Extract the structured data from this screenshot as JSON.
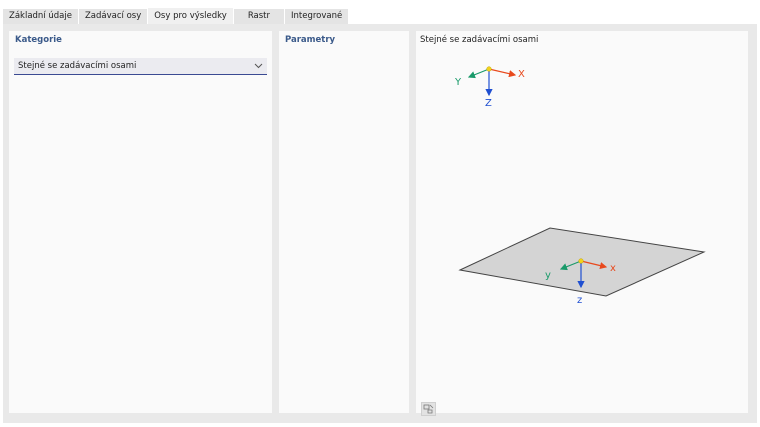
{
  "tabs": [
    {
      "label": "Základní údaje"
    },
    {
      "label": "Zadávací osy"
    },
    {
      "label": "Osy pro výsledky",
      "active": true
    },
    {
      "label": "Rastr"
    },
    {
      "label": "Integrované"
    }
  ],
  "kategorie": {
    "title": "Kategorie",
    "selected": "Stejné se zadávacími osami"
  },
  "parametry": {
    "title": "Parametry"
  },
  "preview": {
    "title": "Stejné se zadávacími osami",
    "global_axes": {
      "x": "X",
      "y": "Y",
      "z": "Z"
    },
    "local_axes": {
      "x": "x",
      "y": "y",
      "z": "z"
    }
  },
  "colors": {
    "x_axis": "#e8491d",
    "y_axis": "#1a9a6a",
    "z_axis": "#1f4fd1",
    "origin": "#f2d21b",
    "title_accent": "#3b5a8a",
    "dropdown_underline": "#3a4a92"
  },
  "icons": {
    "view_tool": "view-settings-icon",
    "dropdown": "chevron-down-icon"
  }
}
